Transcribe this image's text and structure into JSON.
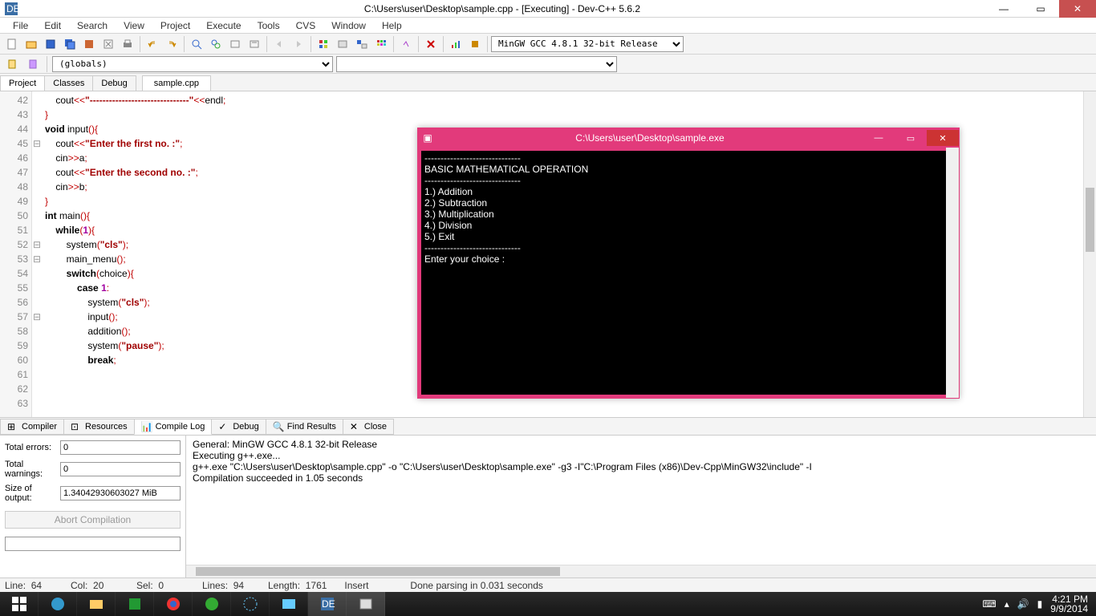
{
  "titlebar": {
    "title": "C:\\Users\\user\\Desktop\\sample.cpp - [Executing] - Dev-C++ 5.6.2"
  },
  "menu": [
    "File",
    "Edit",
    "Search",
    "View",
    "Project",
    "Execute",
    "Tools",
    "CVS",
    "Window",
    "Help"
  ],
  "compiler_dropdown": "MinGW GCC 4.8.1 32-bit Release",
  "scope_dropdown": "(globals)",
  "left_tabs": [
    "Project",
    "Classes",
    "Debug"
  ],
  "file_tab": "sample.cpp",
  "code_lines": [
    {
      "n": 42,
      "fold": "",
      "html": "    cout<span class='op'>&lt;&lt;</span><span class='str'>\"-------------------------------\"</span><span class='op'>&lt;&lt;</span>endl<span class='op'>;</span>"
    },
    {
      "n": 43,
      "fold": "",
      "html": "<span class='op'>}</span>"
    },
    {
      "n": 44,
      "fold": "",
      "html": ""
    },
    {
      "n": 45,
      "fold": "⊟",
      "html": "<span class='kw'>void</span> input<span class='op'>(){</span>"
    },
    {
      "n": 46,
      "fold": "",
      "html": "    cout<span class='op'>&lt;&lt;</span><span class='str'>\"Enter the first no. :\"</span><span class='op'>;</span>"
    },
    {
      "n": 47,
      "fold": "",
      "html": "    cin<span class='op'>&gt;&gt;</span>a<span class='op'>;</span>"
    },
    {
      "n": 48,
      "fold": "",
      "html": "    cout<span class='op'>&lt;&lt;</span><span class='str'>\"Enter the second no. :\"</span><span class='op'>;</span>"
    },
    {
      "n": 49,
      "fold": "",
      "html": "    cin<span class='op'>&gt;&gt;</span>b<span class='op'>;</span>"
    },
    {
      "n": 50,
      "fold": "",
      "html": "<span class='op'>}</span>"
    },
    {
      "n": 51,
      "fold": "",
      "html": ""
    },
    {
      "n": 52,
      "fold": "⊟",
      "html": "<span class='kw'>int</span> main<span class='op'>(){</span>"
    },
    {
      "n": 53,
      "fold": "⊟",
      "html": "    <span class='kw'>while</span><span class='op'>(</span><span class='num'>1</span><span class='op'>){</span>"
    },
    {
      "n": 54,
      "fold": "",
      "html": "        system<span class='op'>(</span><span class='str'>\"cls\"</span><span class='op'>);</span>"
    },
    {
      "n": 55,
      "fold": "",
      "html": "        main_menu<span class='op'>();</span>"
    },
    {
      "n": 56,
      "fold": "",
      "html": ""
    },
    {
      "n": 57,
      "fold": "⊟",
      "html": "        <span class='kw'>switch</span><span class='op'>(</span>choice<span class='op'>){</span>"
    },
    {
      "n": 58,
      "fold": "",
      "html": "            <span class='kw'>case</span> <span class='num'>1</span><span class='op'>:</span>"
    },
    {
      "n": 59,
      "fold": "",
      "html": "                system<span class='op'>(</span><span class='str'>\"cls\"</span><span class='op'>);</span>"
    },
    {
      "n": 60,
      "fold": "",
      "html": "                input<span class='op'>();</span>"
    },
    {
      "n": 61,
      "fold": "",
      "html": "                addition<span class='op'>();</span>"
    },
    {
      "n": 62,
      "fold": "",
      "html": "                system<span class='op'>(</span><span class='str'>\"pause\"</span><span class='op'>);</span>"
    },
    {
      "n": 63,
      "fold": "",
      "html": "                <span class='kw'>break</span><span class='op'>;</span>"
    }
  ],
  "bottom_tabs": [
    "Compiler",
    "Resources",
    "Compile Log",
    "Debug",
    "Find Results",
    "Close"
  ],
  "bottom_active_tab": 2,
  "compile_stats": {
    "total_errors_label": "Total errors:",
    "total_errors": "0",
    "total_warnings_label": "Total warnings:",
    "total_warnings": "0",
    "size_label": "Size of output:",
    "size": "1.34042930603027 MiB",
    "abort_label": "Abort Compilation"
  },
  "compile_log": "General: MinGW GCC 4.8.1 32-bit Release\nExecuting g++.exe...\ng++.exe \"C:\\Users\\user\\Desktop\\sample.cpp\" -o \"C:\\Users\\user\\Desktop\\sample.exe\" -g3 -I\"C:\\Program Files (x86)\\Dev-Cpp\\MinGW32\\include\" -I\nCompilation succeeded in 1.05 seconds",
  "status": {
    "line_label": "Line:",
    "line": "64",
    "col_label": "Col:",
    "col": "20",
    "sel_label": "Sel:",
    "sel": "0",
    "lines_label": "Lines:",
    "lines": "94",
    "length_label": "Length:",
    "length": "1761",
    "mode": "Insert",
    "parse": "Done parsing in 0.031 seconds"
  },
  "console": {
    "title": "C:\\Users\\user\\Desktop\\sample.exe",
    "body": "------------------------------\nBASIC MATHEMATICAL OPERATION\n------------------------------\n1.) Addition\n2.) Subtraction\n3.) Multiplication\n4.) Division\n5.) Exit\n------------------------------\nEnter your choice :"
  },
  "tray": {
    "time": "4:21 PM",
    "date": "9/9/2014"
  }
}
